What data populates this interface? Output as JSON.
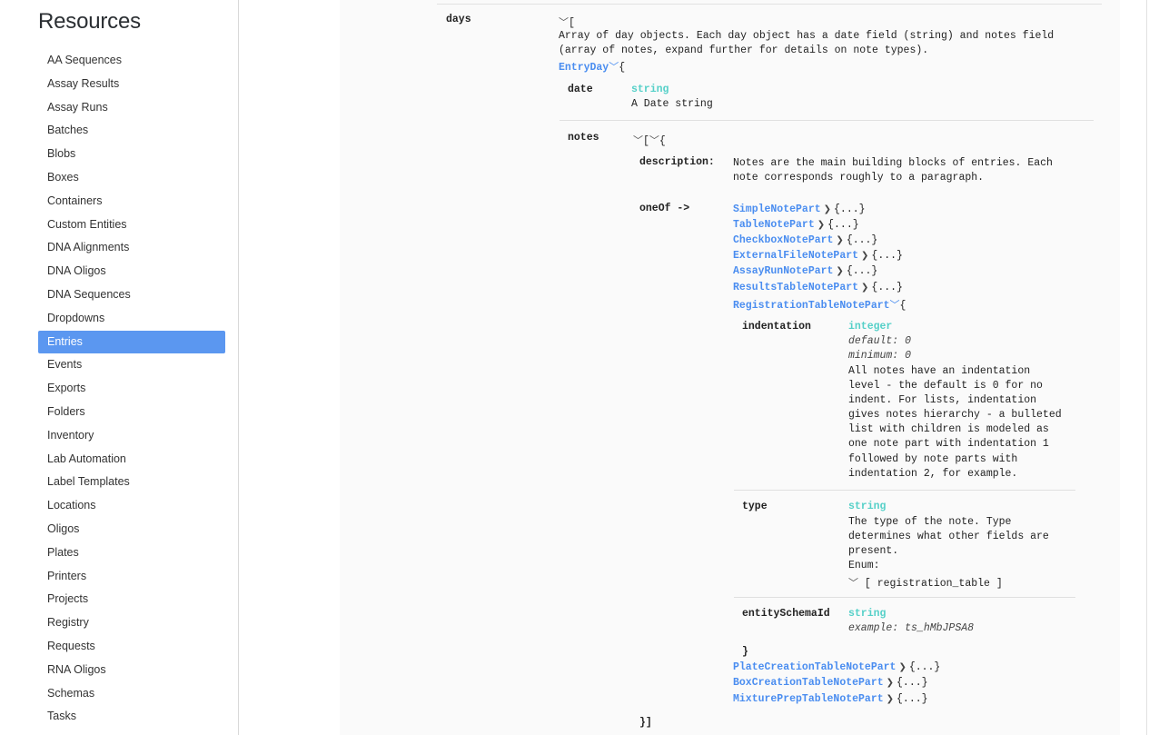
{
  "sidebar": {
    "title": "Resources",
    "items": [
      {
        "label": "AA Sequences"
      },
      {
        "label": "Assay Results"
      },
      {
        "label": "Assay Runs"
      },
      {
        "label": "Batches"
      },
      {
        "label": "Blobs"
      },
      {
        "label": "Boxes"
      },
      {
        "label": "Containers"
      },
      {
        "label": "Custom Entities"
      },
      {
        "label": "DNA Alignments"
      },
      {
        "label": "DNA Oligos"
      },
      {
        "label": "DNA Sequences"
      },
      {
        "label": "Dropdowns"
      },
      {
        "label": "Entries"
      },
      {
        "label": "Events"
      },
      {
        "label": "Exports"
      },
      {
        "label": "Folders"
      },
      {
        "label": "Inventory"
      },
      {
        "label": "Lab Automation"
      },
      {
        "label": "Label Templates"
      },
      {
        "label": "Locations"
      },
      {
        "label": "Oligos"
      },
      {
        "label": "Plates"
      },
      {
        "label": "Printers"
      },
      {
        "label": "Projects"
      },
      {
        "label": "Registry"
      },
      {
        "label": "Requests"
      },
      {
        "label": "RNA Oligos"
      },
      {
        "label": "Schemas"
      },
      {
        "label": "Tasks"
      }
    ],
    "active": "Entries"
  },
  "schema": {
    "days": {
      "name": "days",
      "open_bracket": "[",
      "desc_line1": "Array of day objects. Each day object has a date field (string) and notes field",
      "desc_line2": "(array of notes, expand further for details on note types).",
      "item_ref": "EntryDay",
      "item_open": "{"
    },
    "date": {
      "name": "date",
      "type": "string",
      "desc": "A Date string"
    },
    "notes": {
      "name": "notes",
      "open": "[",
      "open2": "{",
      "description_label": "description:",
      "desc_line1": "Notes are the main building blocks of entries. Each",
      "desc_line2": "note corresponds roughly to a paragraph.",
      "oneof_label": "oneOf ->",
      "collapsed": "{...}",
      "parts_before": [
        "SimpleNotePart",
        "TableNotePart",
        "CheckboxNotePart",
        "ExternalFileNotePart",
        "AssayRunNotePart",
        "ResultsTableNotePart"
      ],
      "expanded_part": "RegistrationTableNotePart",
      "expanded_open": "{",
      "parts_after": [
        "PlateCreationTableNotePart",
        "BoxCreationTableNotePart",
        "MixturePrepTableNotePart"
      ],
      "close_inner": "}",
      "close_outer": "}]"
    },
    "indentation": {
      "name": "indentation",
      "type": "integer",
      "default": "default: 0",
      "minimum": "minimum: 0",
      "desc": [
        "All notes have an indentation",
        "level - the default is 0 for no",
        "indent. For lists, indentation",
        "gives notes hierarchy - a bulleted",
        "list with children is modeled as",
        "one note part with indentation 1",
        "followed by note parts with",
        "indentation 2, for example."
      ]
    },
    "type_field": {
      "name": "type",
      "type": "string",
      "desc": [
        "The type of the note. Type",
        "determines what other fields are",
        "present."
      ],
      "enum_label": "Enum:",
      "enum_value": "[ registration_table ]"
    },
    "entitySchemaId": {
      "name": "entitySchemaId",
      "type": "string",
      "example": "example: ts_hMbJPSA8"
    }
  }
}
